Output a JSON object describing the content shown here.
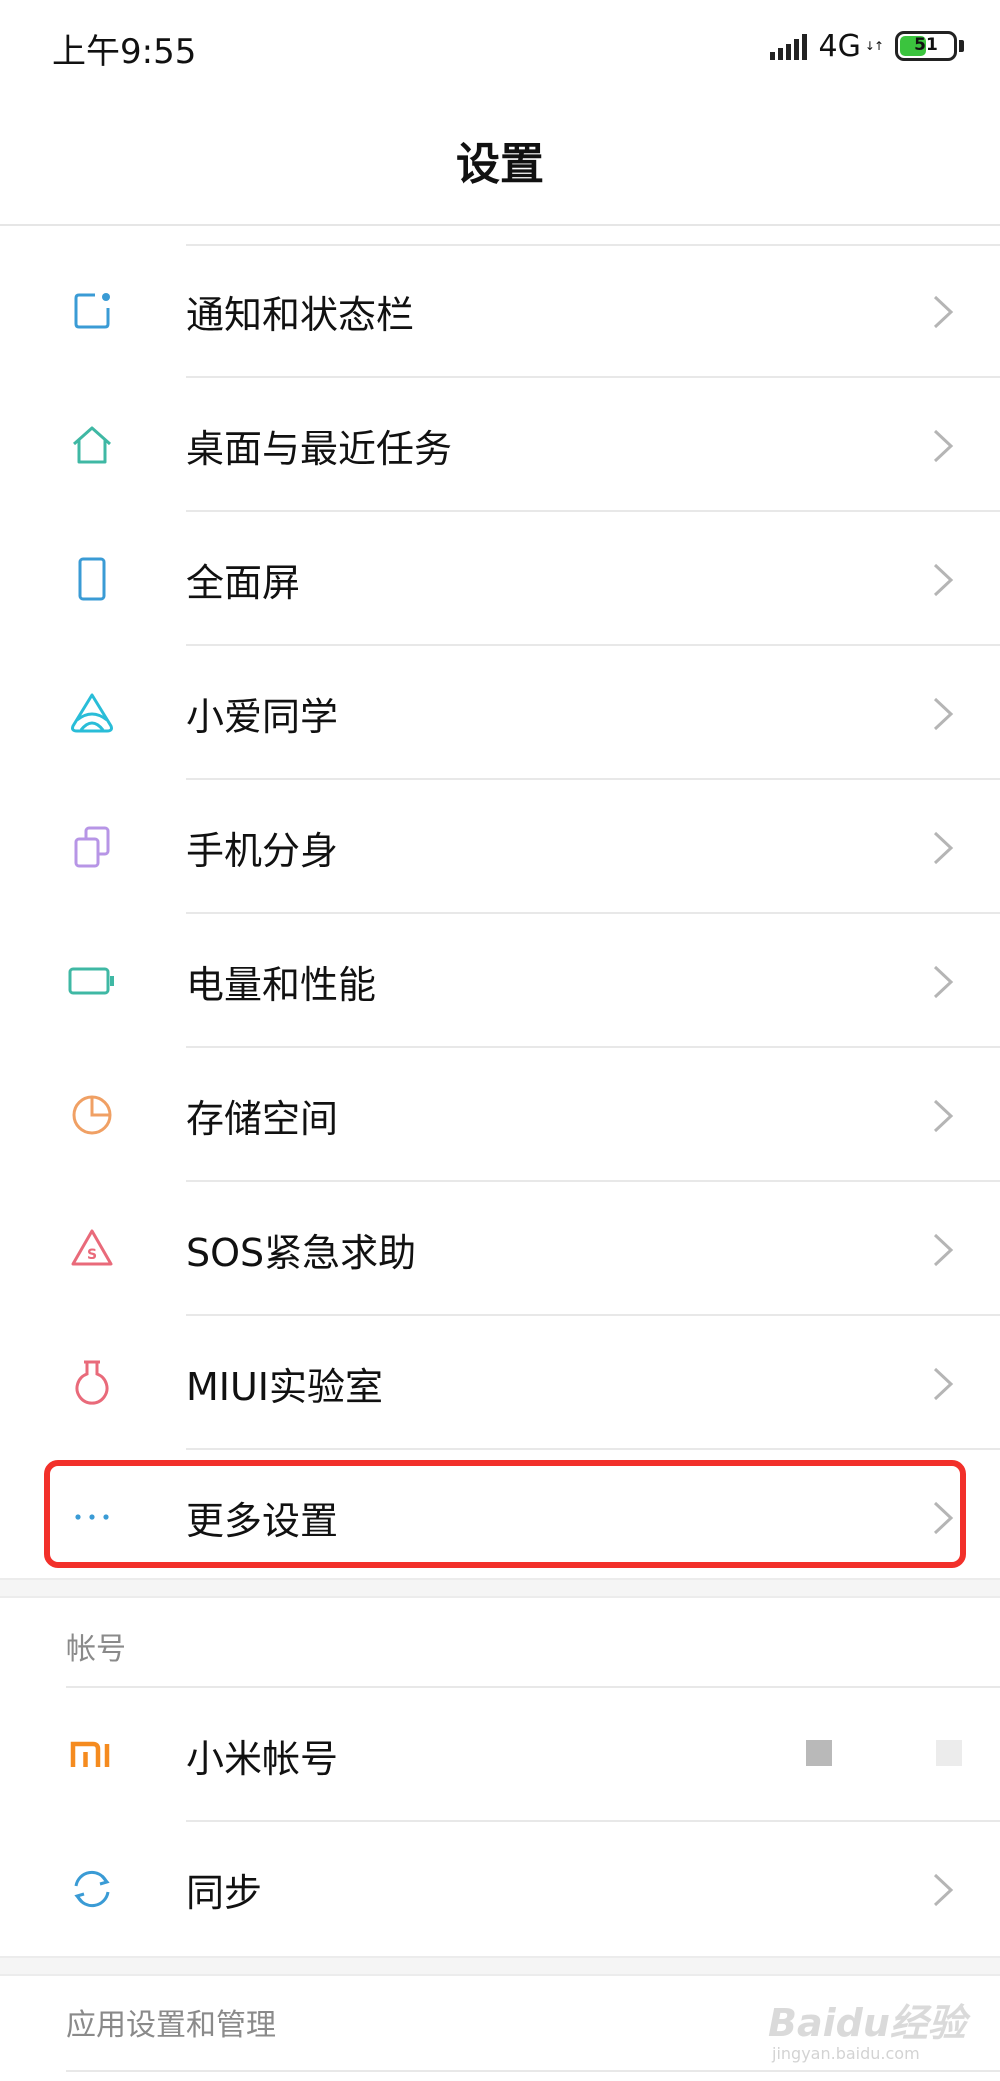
{
  "status_bar": {
    "time": "上午9:55",
    "network": "4G",
    "battery_level": "51",
    "battery_fraction": 0.51
  },
  "header": {
    "title": "设置"
  },
  "settings_list": [
    {
      "label": "通知和状态栏",
      "icon": "notification-icon",
      "color": "#3a9bd5"
    },
    {
      "label": "桌面与最近任务",
      "icon": "home-icon",
      "color": "#3fb8a4"
    },
    {
      "label": "全面屏",
      "icon": "phone-screen-icon",
      "color": "#3a9bd5"
    },
    {
      "label": "小爱同学",
      "icon": "xiaoai-icon",
      "color": "#29bdd8"
    },
    {
      "label": "手机分身",
      "icon": "dual-space-icon",
      "color": "#b795e6"
    },
    {
      "label": "电量和性能",
      "icon": "battery-icon",
      "color": "#3fb8a4"
    },
    {
      "label": "存储空间",
      "icon": "storage-pie-icon",
      "color": "#f0a064"
    },
    {
      "label": "SOS紧急求助",
      "icon": "sos-icon",
      "color": "#e96a7a"
    },
    {
      "label": "MIUI实验室",
      "icon": "lab-flask-icon",
      "color": "#e96a7a"
    },
    {
      "label": "更多设置",
      "icon": "more-dots-icon",
      "color": "#3a9bd5"
    }
  ],
  "account_section": {
    "header": "帐号",
    "items": [
      {
        "label": "小米帐号",
        "icon": "mi-logo-icon",
        "color": "#f58b1f"
      },
      {
        "label": "同步",
        "icon": "sync-icon",
        "color": "#3a9bd5"
      }
    ]
  },
  "apps_section": {
    "header": "应用设置和管理"
  },
  "watermark": {
    "text": "Baidu经验",
    "sub": "jingyan.baidu.com"
  },
  "colors": {
    "highlight": "#f2302a",
    "chevron": "#b5b5b5",
    "divider": "#e8e8e8"
  }
}
